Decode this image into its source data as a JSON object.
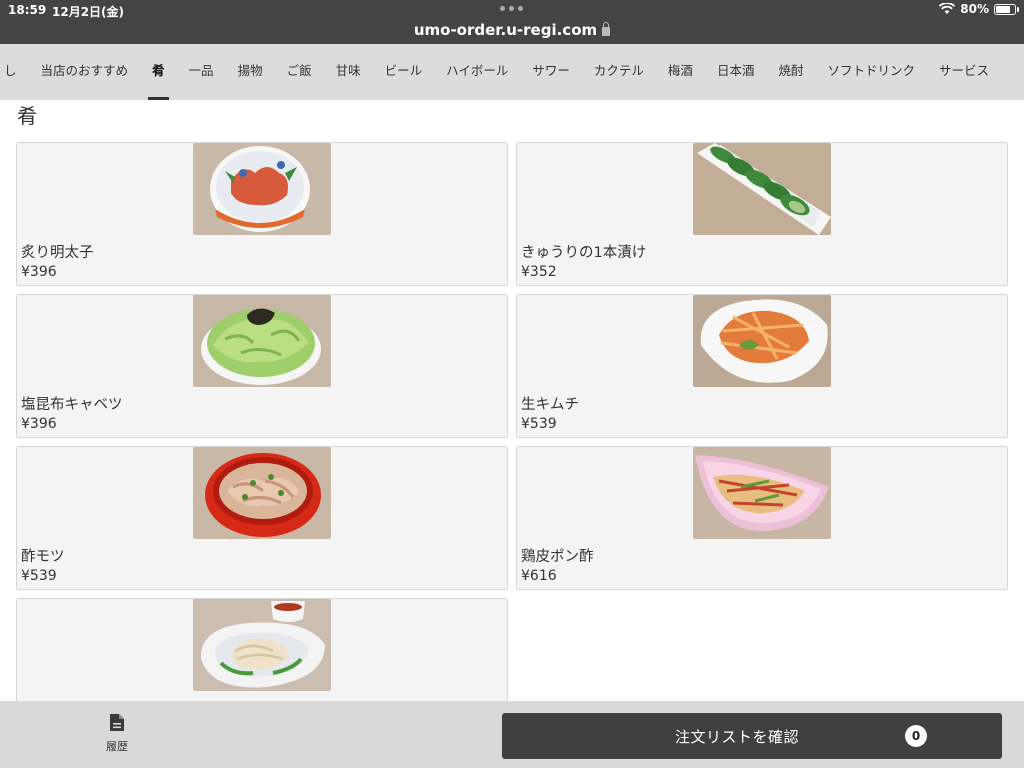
{
  "status_bar": {
    "time": "18:59",
    "date": "12月2日(金)",
    "battery": "80%",
    "battery_level": 0.8
  },
  "browser": {
    "url": "umo-order.u-regi.com"
  },
  "nav": {
    "tabs": [
      {
        "label": "し",
        "active": false
      },
      {
        "label": "当店のおすすめ",
        "active": false
      },
      {
        "label": "肴",
        "active": true
      },
      {
        "label": "一品",
        "active": false
      },
      {
        "label": "揚物",
        "active": false
      },
      {
        "label": "ご飯",
        "active": false
      },
      {
        "label": "甘味",
        "active": false
      },
      {
        "label": "ビール",
        "active": false
      },
      {
        "label": "ハイボール",
        "active": false
      },
      {
        "label": "サワー",
        "active": false
      },
      {
        "label": "カクテル",
        "active": false
      },
      {
        "label": "梅酒",
        "active": false
      },
      {
        "label": "日本酒",
        "active": false
      },
      {
        "label": "焼酎",
        "active": false
      },
      {
        "label": "ソフトドリンク",
        "active": false
      },
      {
        "label": "サービス",
        "active": false
      }
    ]
  },
  "section": {
    "title": "肴"
  },
  "items": [
    {
      "name": "炙り明太子",
      "price": "¥396"
    },
    {
      "name": "きゅうりの1本漬け",
      "price": "¥352"
    },
    {
      "name": "塩昆布キャベツ",
      "price": "¥396"
    },
    {
      "name": "生キムチ",
      "price": "¥539"
    },
    {
      "name": "酢モツ",
      "price": "¥539"
    },
    {
      "name": "鶏皮ポン酢",
      "price": "¥616"
    },
    {
      "name": "",
      "price": ""
    }
  ],
  "footer": {
    "history_label": "履歴",
    "order_label": "注文リストを確認",
    "order_count": "0"
  }
}
